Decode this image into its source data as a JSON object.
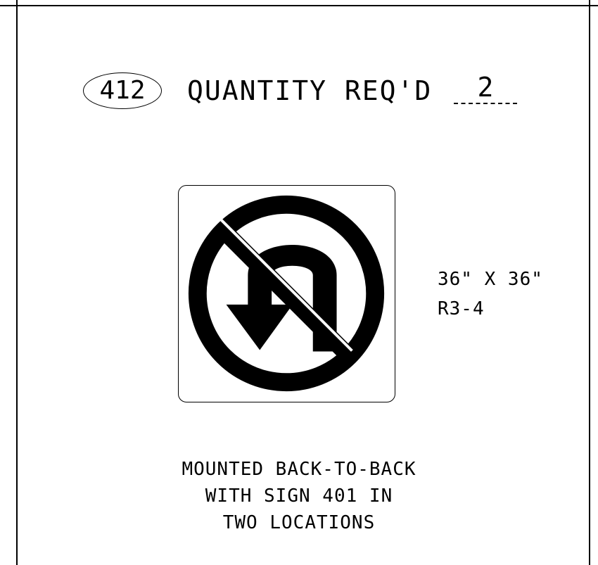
{
  "sign": {
    "number": "412",
    "quantity_label": "QUANTITY REQ'D",
    "quantity_value": "2",
    "symbol_icon": "no-u-turn-icon",
    "size": "36\" X 36\"",
    "code": "R3-4"
  },
  "note": {
    "lines": [
      "MOUNTED BACK-TO-BACK",
      "WITH SIGN 401 IN",
      "TWO LOCATIONS"
    ]
  }
}
